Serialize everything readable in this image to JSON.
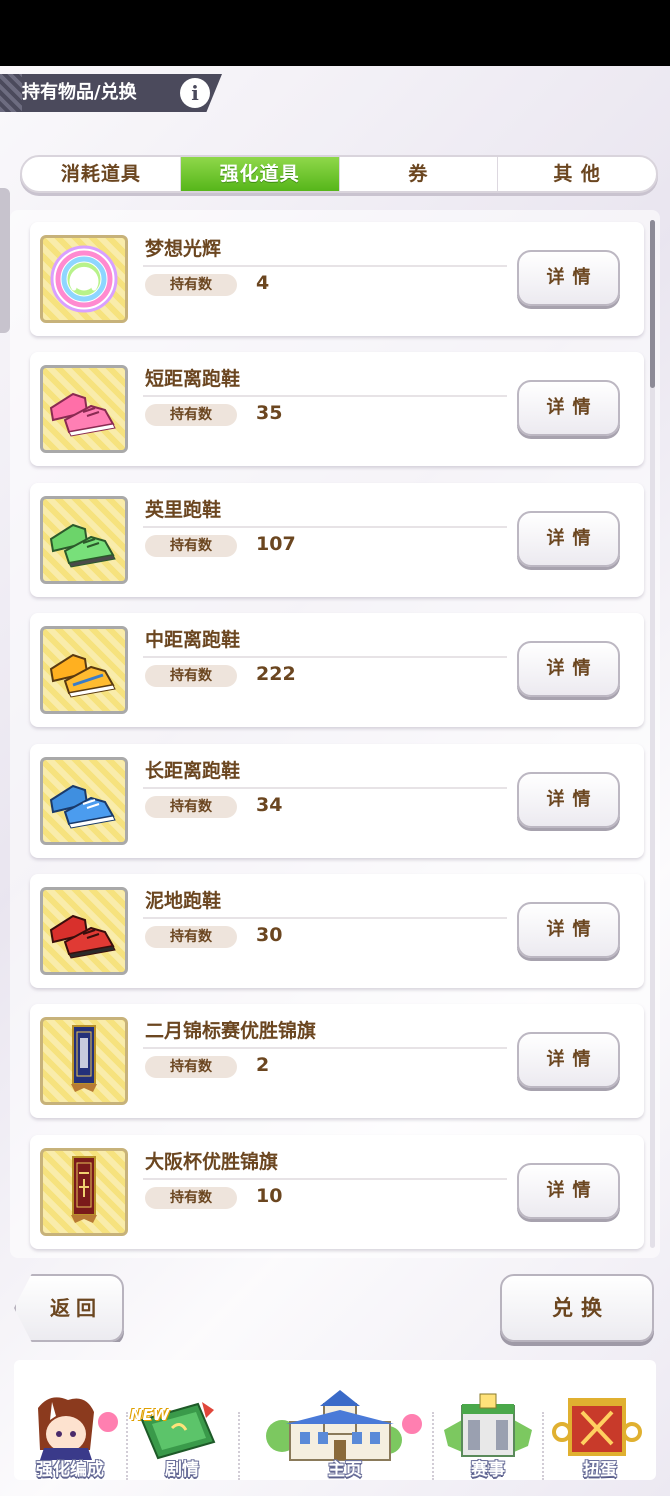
{
  "header": {
    "title": "持有物品/兑换",
    "info_icon": "info-icon"
  },
  "tabs": [
    {
      "label": "消耗道具",
      "active": false
    },
    {
      "label": "强化道具",
      "active": true
    },
    {
      "label": "券",
      "active": false
    },
    {
      "label": "其 他",
      "active": false
    }
  ],
  "qty_label": "持有数",
  "detail_label": "详情",
  "items": [
    {
      "name": "梦想光辉",
      "qty": "4",
      "icon": "rainbow-horseshoe-icon"
    },
    {
      "name": "短距离跑鞋",
      "qty": "35",
      "icon": "pink-shoes-icon"
    },
    {
      "name": "英里跑鞋",
      "qty": "107",
      "icon": "green-shoes-icon"
    },
    {
      "name": "中距离跑鞋",
      "qty": "222",
      "icon": "orange-shoes-icon"
    },
    {
      "name": "长距离跑鞋",
      "qty": "34",
      "icon": "blue-shoes-icon"
    },
    {
      "name": "泥地跑鞋",
      "qty": "30",
      "icon": "red-shoes-icon"
    },
    {
      "name": "二月锦标赛优胜锦旗",
      "qty": "2",
      "icon": "navy-pennant-icon"
    },
    {
      "name": "大阪杯优胜锦旗",
      "qty": "10",
      "icon": "red-pennant-icon"
    }
  ],
  "buttons": {
    "back": "返回",
    "exchange": "兑换"
  },
  "nav": [
    {
      "label": "强化编成",
      "icon": "horse-girl-icon"
    },
    {
      "label": "剧情",
      "icon": "story-book-icon",
      "tag": "NEW"
    },
    {
      "label": "主页",
      "icon": "school-building-icon"
    },
    {
      "label": "赛事",
      "icon": "race-gate-icon"
    },
    {
      "label": "扭蛋",
      "icon": "gacha-banner-icon"
    }
  ],
  "colors": {
    "tab_active": "#56b61a",
    "text_brown": "#6b4620",
    "header_bg": "#4b4a5c"
  }
}
